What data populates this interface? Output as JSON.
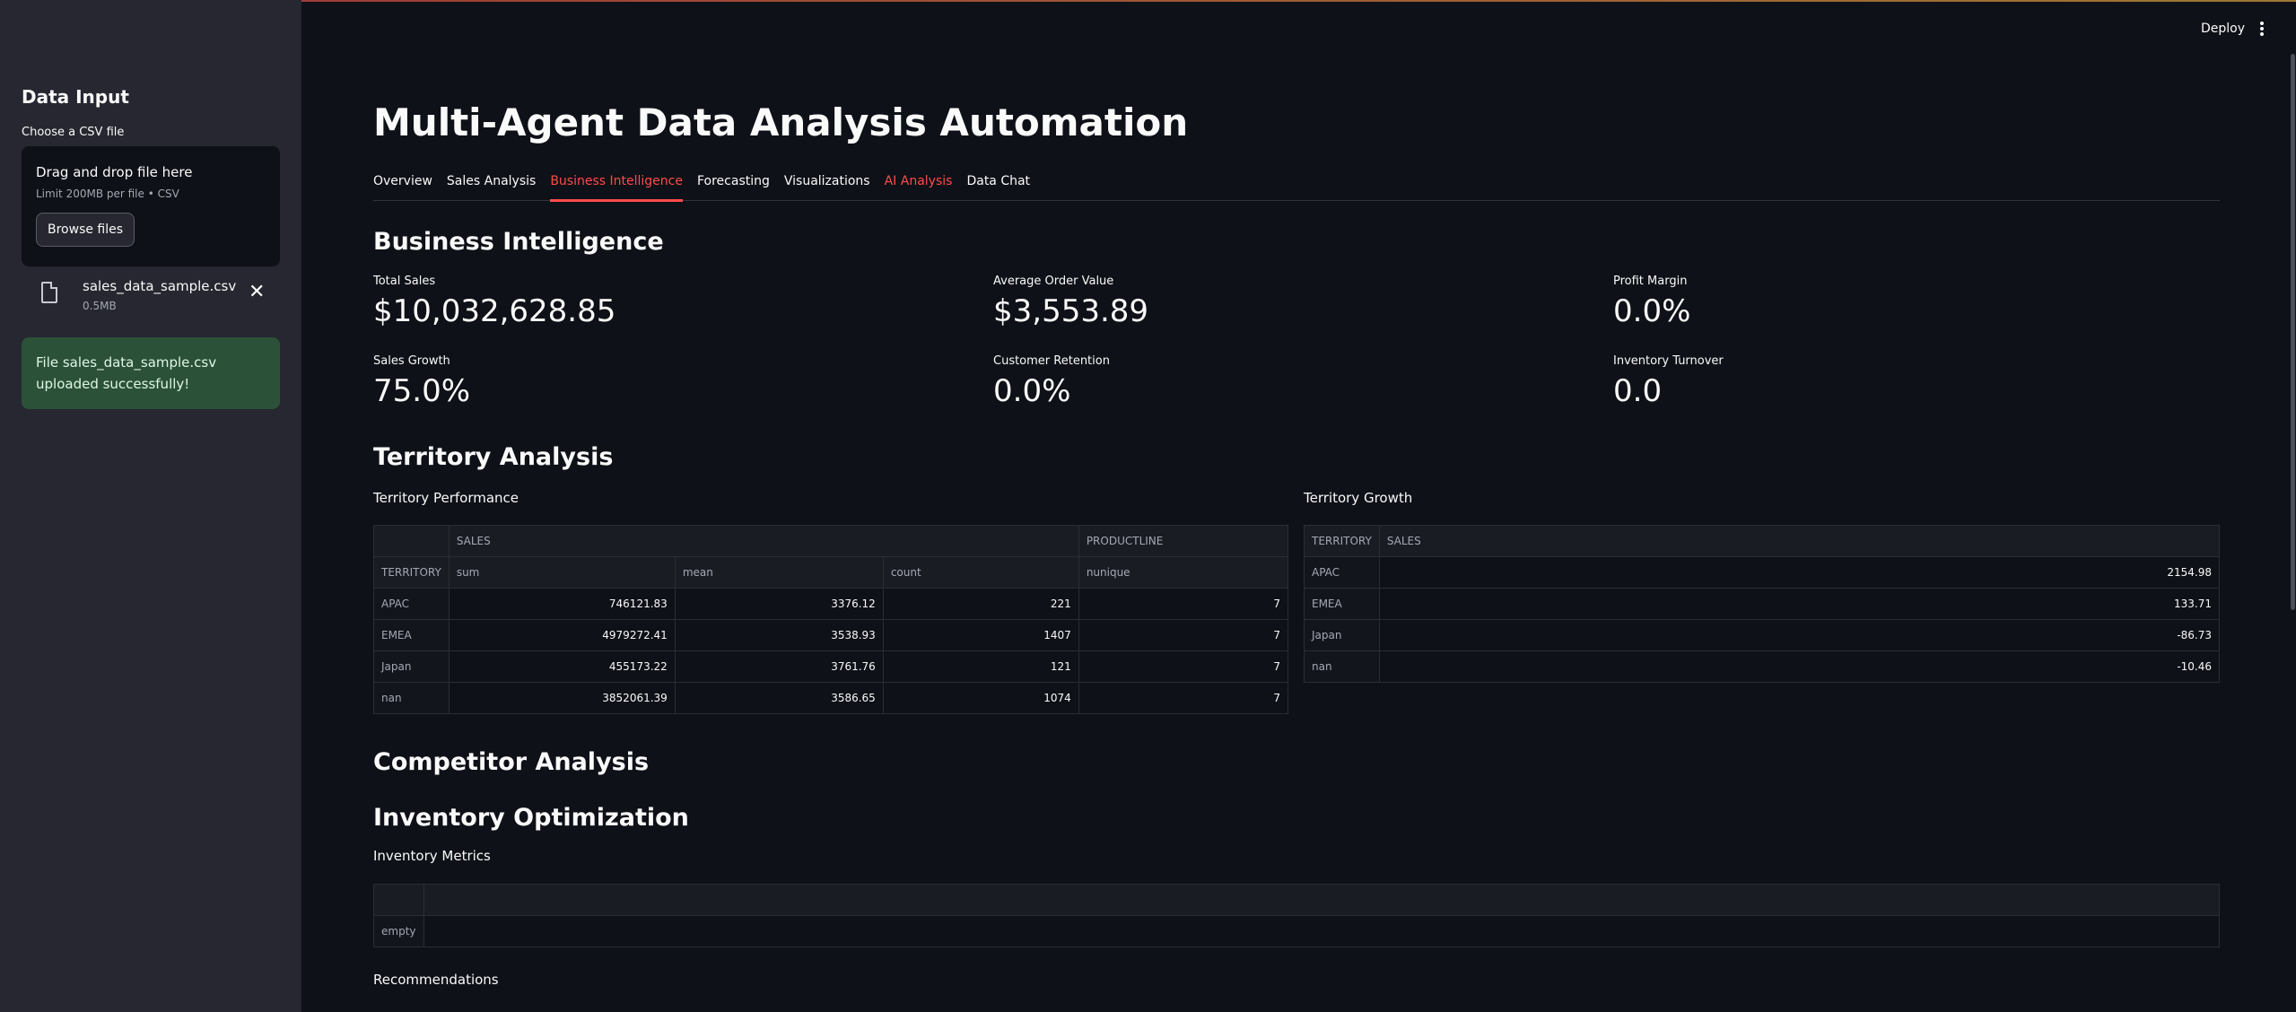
{
  "sidebar": {
    "title": "Data Input",
    "upload_label": "Choose a CSV file",
    "dropzone_title": "Drag and drop file here",
    "dropzone_limit": "Limit 200MB per file • CSV",
    "browse_label": "Browse files",
    "file_name": "sales_data_sample.csv",
    "file_size": "0.5MB",
    "success_message": "File sales_data_sample.csv uploaded successfully!"
  },
  "header": {
    "deploy_label": "Deploy"
  },
  "main": {
    "title": "Multi-Agent Data Analysis Automation",
    "tabs": [
      {
        "label": "Overview"
      },
      {
        "label": "Sales Analysis"
      },
      {
        "label": "Business Intelligence"
      },
      {
        "label": "Forecasting"
      },
      {
        "label": "Visualizations"
      },
      {
        "label": "AI Analysis"
      },
      {
        "label": "Data Chat"
      }
    ],
    "bi_heading": "Business Intelligence",
    "metrics": [
      {
        "label": "Total Sales",
        "value": "$10,032,628.85"
      },
      {
        "label": "Average Order Value",
        "value": "$3,553.89"
      },
      {
        "label": "Profit Margin",
        "value": "0.0%"
      },
      {
        "label": "Sales Growth",
        "value": "75.0%"
      },
      {
        "label": "Customer Retention",
        "value": "0.0%"
      },
      {
        "label": "Inventory Turnover",
        "value": "0.0"
      }
    ],
    "territory_heading": "Territory Analysis",
    "territory_performance": {
      "title": "Territory Performance",
      "group_headers": [
        "SALES",
        "PRODUCTLINE"
      ],
      "index_name": "TERRITORY",
      "columns": [
        "sum",
        "mean",
        "count",
        "nunique"
      ],
      "rows": [
        {
          "name": "APAC",
          "cells": [
            "746121.83",
            "3376.12",
            "221",
            "7"
          ]
        },
        {
          "name": "EMEA",
          "cells": [
            "4979272.41",
            "3538.93",
            "1407",
            "7"
          ]
        },
        {
          "name": "Japan",
          "cells": [
            "455173.22",
            "3761.76",
            "121",
            "7"
          ]
        },
        {
          "name": "nan",
          "cells": [
            "3852061.39",
            "3586.65",
            "1074",
            "7"
          ]
        }
      ]
    },
    "territory_growth": {
      "title": "Territory Growth",
      "columns": [
        "TERRITORY",
        "SALES"
      ],
      "rows": [
        {
          "name": "APAC",
          "value": "2154.98"
        },
        {
          "name": "EMEA",
          "value": "133.71"
        },
        {
          "name": "Japan",
          "value": "-86.73"
        },
        {
          "name": "nan",
          "value": "-10.46"
        }
      ]
    },
    "competitor_heading": "Competitor Analysis",
    "inventory_heading": "Inventory Optimization",
    "inventory_metrics_title": "Inventory Metrics",
    "inventory_empty": "empty",
    "recommendations_title": "Recommendations"
  },
  "colors": {
    "accent": "#ff4b4b",
    "background": "#0e1117",
    "sidebar": "#262730",
    "success": "#2b5138"
  }
}
